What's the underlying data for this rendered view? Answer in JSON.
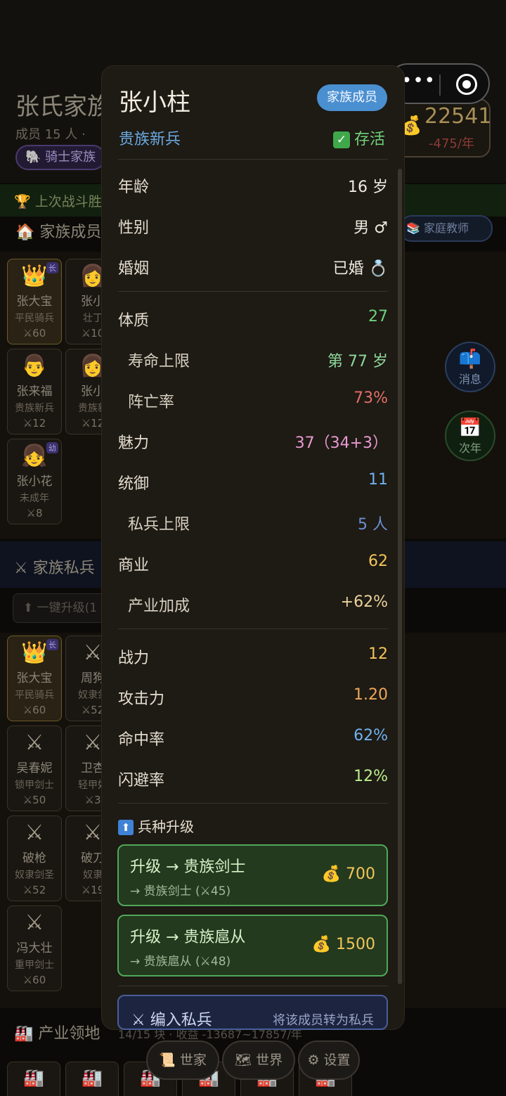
{
  "background": {
    "family_name": "张氏家族",
    "member_count": "成员 15 人 ·",
    "family_type": "🐘 骑士家族",
    "gold": "22541",
    "gold_rate": "-475/年",
    "battle_banner": "🏆 上次战斗胜",
    "members_section": "🏠 家族成员",
    "teacher_button": "📚 家庭教师",
    "members": [
      {
        "icon": "👑",
        "name": "张大宝",
        "rank": "平民骑兵",
        "power": "⚔60",
        "tag": "长"
      },
      {
        "icon": "👩",
        "name": "张小",
        "rank": "壮丁",
        "power": "⚔10",
        "tag": ""
      },
      {
        "icon": "👨",
        "name": "张来福",
        "rank": "贵族新兵",
        "power": "⚔12",
        "tag": ""
      },
      {
        "icon": "👩",
        "name": "张小",
        "rank": "贵族新",
        "power": "⚔12",
        "tag": ""
      },
      {
        "icon": "👧",
        "name": "张小花",
        "rank": "未成年",
        "power": "⚔8",
        "tag": "幼"
      }
    ],
    "soldiers_section": "⚔ 家族私兵",
    "upgrade_all": "⬆ 一键升级(1",
    "soldiers": [
      {
        "icon": "👑",
        "name": "张大宝",
        "rank": "平民骑兵",
        "power": "⚔60",
        "tag": "长"
      },
      {
        "icon": "⚔",
        "name": "周狗",
        "rank": "奴隶剑",
        "power": "⚔52",
        "tag": ""
      },
      {
        "icon": "⚔",
        "name": "吴春妮",
        "rank": "锁甲剑士",
        "power": "⚔50",
        "tag": ""
      },
      {
        "icon": "⚔",
        "name": "卫杏",
        "rank": "轻甲奴",
        "power": "⚔3",
        "tag": ""
      },
      {
        "icon": "⚔",
        "name": "破枪",
        "rank": "奴隶剑圣",
        "power": "⚔52",
        "tag": ""
      },
      {
        "icon": "⚔",
        "name": "破刀",
        "rank": "奴隶",
        "power": "⚔19",
        "tag": ""
      },
      {
        "icon": "⚔",
        "name": "冯大壮",
        "rank": "重甲剑士",
        "power": "⚔60",
        "tag": ""
      }
    ],
    "message_button": "消息",
    "next_year_button": "次年",
    "industry_section": "🏭 产业领地",
    "industry_info": "14/15 块 · 收益 -13687~17857/年",
    "nav": {
      "family": "📜 世家",
      "world": "🗺 世界",
      "settings": "⚙ 设置"
    }
  },
  "modal": {
    "name": "张小柱",
    "tag": "家族成员",
    "rank": "贵族新兵",
    "status": "存活",
    "age_label": "年龄",
    "age_value": "16 岁",
    "gender_label": "性别",
    "gender_value": "男 ♂",
    "marriage_label": "婚姻",
    "marriage_value": "已婚 💍",
    "constitution_label": "体质",
    "constitution_value": "27",
    "lifespan_label": "寿命上限",
    "lifespan_value": "第 77 岁",
    "death_rate_label": "阵亡率",
    "death_rate_value": "73%",
    "charm_label": "魅力",
    "charm_value": "37（34+3）",
    "command_label": "统御",
    "command_value": "11",
    "troop_cap_label": "私兵上限",
    "troop_cap_value": "5 人",
    "business_label": "商业",
    "business_value": "62",
    "industry_bonus_label": "产业加成",
    "industry_bonus_value": "+62%",
    "power_label": "战力",
    "power_value": "12",
    "attack_label": "攻击力",
    "attack_value": "1.20",
    "hit_label": "命中率",
    "hit_value": "62%",
    "dodge_label": "闪避率",
    "dodge_value": "12%",
    "upgrade_header": "兵种升级",
    "upgrades": [
      {
        "title": "升级 → 贵族剑士",
        "sub": "→ 贵族剑士 (⚔45)",
        "cost": "💰 700"
      },
      {
        "title": "升级 → 贵族扈从",
        "sub": "→ 贵族扈从 (⚔48)",
        "cost": "💰 1500"
      }
    ],
    "enlist_label": "⚔ 编入私兵",
    "enlist_note": "将该成员转为私兵"
  }
}
